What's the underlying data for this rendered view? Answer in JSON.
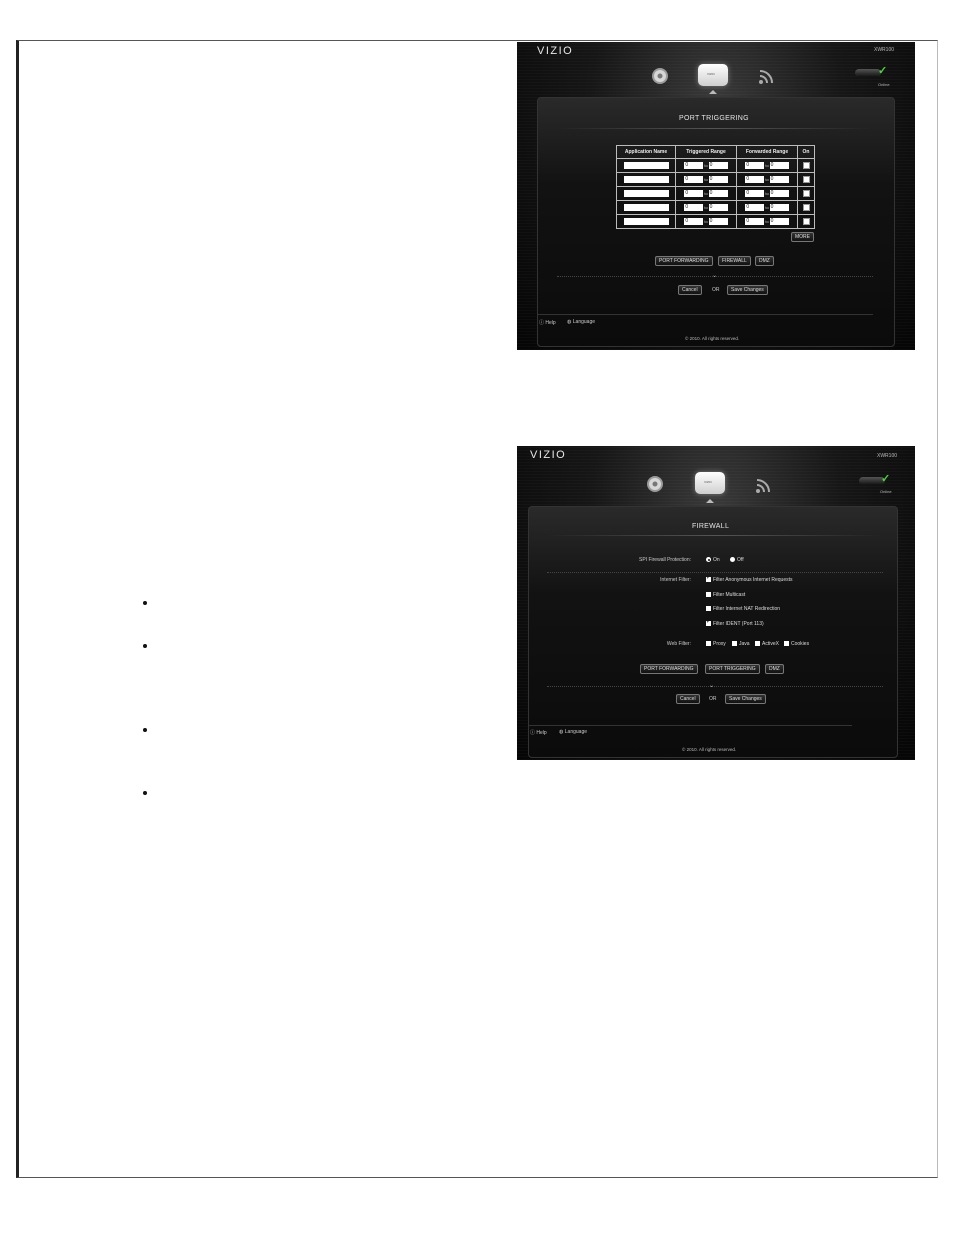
{
  "bullets": [
    "",
    "",
    "",
    ""
  ],
  "port_triggering": {
    "logo": "VIZIO",
    "model": "XWR100",
    "status": "Online",
    "router_label": "VIZIO",
    "title": "PORT TRIGGERING",
    "headers": [
      "Application Name",
      "Triggered Range",
      "Forwarded Range",
      "On"
    ],
    "to_label": "to",
    "rows": [
      {
        "t1": "0",
        "t2": "0",
        "f1": "0",
        "f2": "0",
        "on": false
      },
      {
        "t1": "0",
        "t2": "0",
        "f1": "0",
        "f2": "0",
        "on": false
      },
      {
        "t1": "0",
        "t2": "0",
        "f1": "0",
        "f2": "0",
        "on": false
      },
      {
        "t1": "0",
        "t2": "0",
        "f1": "0",
        "f2": "0",
        "on": false
      },
      {
        "t1": "0",
        "t2": "0",
        "f1": "0",
        "f2": "0",
        "on": false
      }
    ],
    "more": "MORE",
    "nav": [
      "PORT FORWARDING",
      "FIREWALL",
      "DMZ"
    ],
    "cancel": "Cancel",
    "or": "OR",
    "save": "Save Changes",
    "help": "Help",
    "language": "Language",
    "copyright": "© 2010. All rights reserved."
  },
  "firewall": {
    "logo": "VIZIO",
    "model": "XWR100",
    "status": "Online",
    "router_label": "VIZIO",
    "title": "FIREWALL",
    "spi_label": "SPI Firewall Protection:",
    "spi_on": "On",
    "spi_off": "Off",
    "internet_label": "Internet Filter:",
    "internet_options": [
      {
        "label": "Filter Anonymous Internet Requests",
        "checked": true
      },
      {
        "label": "Filter Multicast",
        "checked": false
      },
      {
        "label": "Filter Internet NAT Redirection",
        "checked": false
      },
      {
        "label": "Filter IDENT (Port 113)",
        "checked": true
      }
    ],
    "web_label": "Web Filter:",
    "web_options": [
      {
        "label": "Proxy",
        "checked": false
      },
      {
        "label": "Java",
        "checked": false
      },
      {
        "label": "ActiveX",
        "checked": false
      },
      {
        "label": "Cookies",
        "checked": false
      }
    ],
    "nav": [
      "PORT FORWARDING",
      "PORT TRIGGERING",
      "DMZ"
    ],
    "cancel": "Cancel",
    "or": "OR",
    "save": "Save Changes",
    "help": "Help",
    "language": "Language",
    "copyright": "© 2010. All rights reserved."
  }
}
